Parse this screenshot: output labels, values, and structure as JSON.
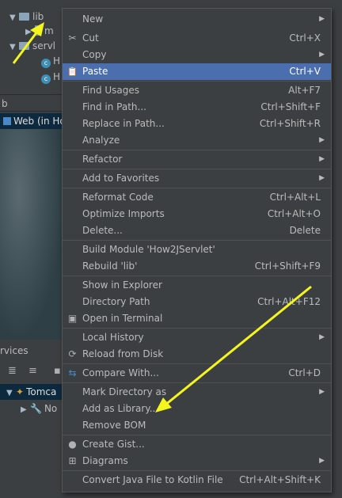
{
  "tree": {
    "top_partial": "",
    "lib_label": "lib",
    "jar_label": "m",
    "servlet_label": "servl",
    "h1": "H",
    "h2": "H",
    "panel_label": "b",
    "web_label": "Web (in Ho"
  },
  "services": {
    "label": "rvices",
    "tomcat": "Tomca",
    "not": "No"
  },
  "menu": {
    "items": [
      {
        "label": "New",
        "shortcut": "",
        "submenu": true,
        "icon": ""
      },
      {
        "label": "Cut",
        "shortcut": "Ctrl+X",
        "submenu": false,
        "icon": "scissors-icon"
      },
      {
        "label": "Copy",
        "shortcut": "",
        "submenu": true,
        "icon": ""
      },
      {
        "label": "Paste",
        "shortcut": "Ctrl+V",
        "submenu": false,
        "icon": "clipboard-icon",
        "selected": true
      },
      {
        "label": "Find Usages",
        "shortcut": "Alt+F7",
        "submenu": false,
        "icon": ""
      },
      {
        "label": "Find in Path...",
        "shortcut": "Ctrl+Shift+F",
        "submenu": false,
        "icon": ""
      },
      {
        "label": "Replace in Path...",
        "shortcut": "Ctrl+Shift+R",
        "submenu": false,
        "icon": ""
      },
      {
        "label": "Analyze",
        "shortcut": "",
        "submenu": true,
        "icon": ""
      },
      {
        "label": "Refactor",
        "shortcut": "",
        "submenu": true,
        "icon": ""
      },
      {
        "label": "Add to Favorites",
        "shortcut": "",
        "submenu": true,
        "icon": ""
      },
      {
        "label": "Reformat Code",
        "shortcut": "Ctrl+Alt+L",
        "submenu": false,
        "icon": ""
      },
      {
        "label": "Optimize Imports",
        "shortcut": "Ctrl+Alt+O",
        "submenu": false,
        "icon": ""
      },
      {
        "label": "Delete...",
        "shortcut": "Delete",
        "submenu": false,
        "icon": ""
      },
      {
        "label": "Build Module 'How2JServlet'",
        "shortcut": "",
        "submenu": false,
        "icon": ""
      },
      {
        "label": "Rebuild 'lib'",
        "shortcut": "Ctrl+Shift+F9",
        "submenu": false,
        "icon": ""
      },
      {
        "label": "Show in Explorer",
        "shortcut": "",
        "submenu": false,
        "icon": ""
      },
      {
        "label": "Directory Path",
        "shortcut": "Ctrl+Alt+F12",
        "submenu": false,
        "icon": ""
      },
      {
        "label": "Open in Terminal",
        "shortcut": "",
        "submenu": false,
        "icon": "terminal-icon"
      },
      {
        "label": "Local History",
        "shortcut": "",
        "submenu": true,
        "icon": ""
      },
      {
        "label": "Reload from Disk",
        "shortcut": "",
        "submenu": false,
        "icon": "reload-icon"
      },
      {
        "label": "Compare With...",
        "shortcut": "Ctrl+D",
        "submenu": false,
        "icon": "compare-icon"
      },
      {
        "label": "Mark Directory as",
        "shortcut": "",
        "submenu": true,
        "icon": ""
      },
      {
        "label": "Add as Library...",
        "shortcut": "",
        "submenu": false,
        "icon": ""
      },
      {
        "label": "Remove BOM",
        "shortcut": "",
        "submenu": false,
        "icon": ""
      },
      {
        "label": "Create Gist...",
        "shortcut": "",
        "submenu": false,
        "icon": "github-icon"
      },
      {
        "label": "Diagrams",
        "shortcut": "",
        "submenu": true,
        "icon": "diagram-icon"
      },
      {
        "label": "Convert Java File to Kotlin File",
        "shortcut": "Ctrl+Alt+Shift+K",
        "submenu": false,
        "icon": ""
      }
    ]
  },
  "colors": {
    "menu_bg": "#3c3f41",
    "selection": "#4b6eaf",
    "annotation_arrow": "#f5f51e"
  }
}
